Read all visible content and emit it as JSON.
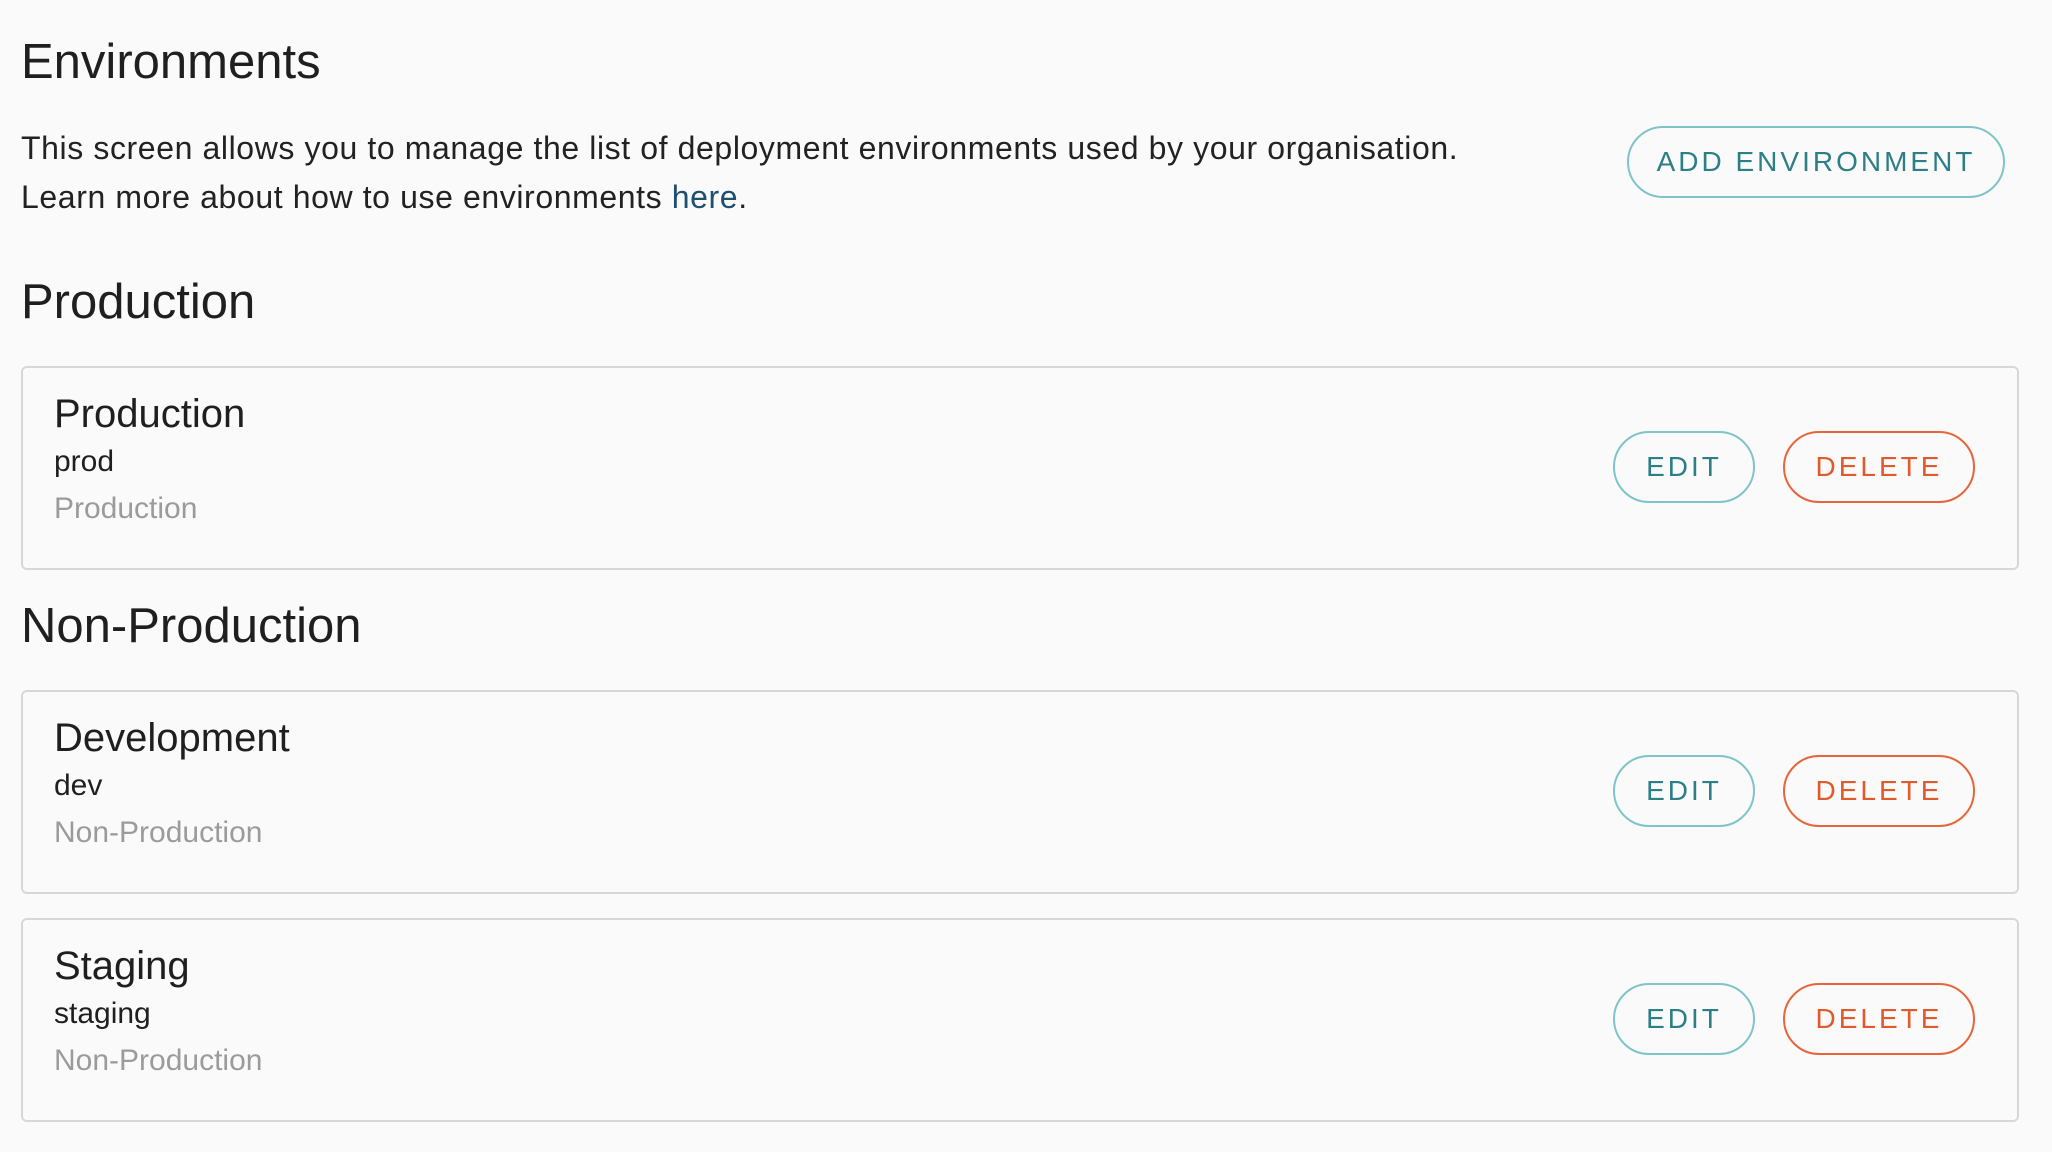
{
  "header": {
    "title": "Environments",
    "intro_line1": "This screen allows you to manage the list of deployment environments used by your organisation.",
    "intro_line2_prefix": "Learn more about how to use environments ",
    "intro_link": "here",
    "intro_line2_suffix": ".",
    "add_button": "ADD ENVIRONMENT"
  },
  "sections": [
    {
      "title": "Production",
      "environments": [
        {
          "name": "Production",
          "slug": "prod",
          "type": "Production",
          "edit_label": "EDIT",
          "delete_label": "DELETE"
        }
      ]
    },
    {
      "title": "Non-Production",
      "environments": [
        {
          "name": "Development",
          "slug": "dev",
          "type": "Non-Production",
          "edit_label": "EDIT",
          "delete_label": "DELETE"
        },
        {
          "name": "Staging",
          "slug": "staging",
          "type": "Non-Production",
          "edit_label": "EDIT",
          "delete_label": "DELETE"
        }
      ]
    }
  ],
  "colors": {
    "primary_accent": "#2c7f86",
    "danger_accent": "#e05a2c",
    "link": "#1e4f6e",
    "muted_text": "#9b9b9b"
  }
}
